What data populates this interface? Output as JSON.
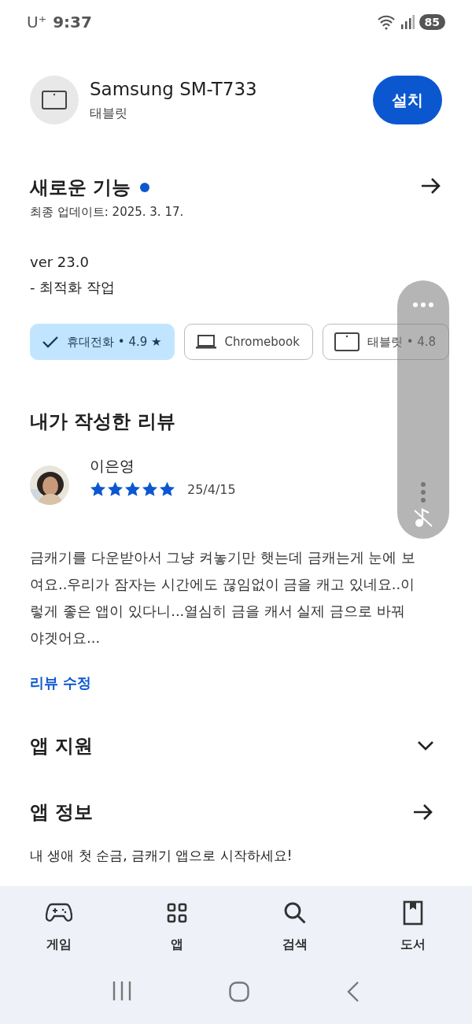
{
  "status_bar": {
    "carrier": "U⁺",
    "time": "9:37",
    "battery": "85"
  },
  "device": {
    "name": "Samsung SM-T733",
    "type": "태블릿",
    "install_button": "설치"
  },
  "whats_new": {
    "title": "새로운 기능",
    "new_dot": true,
    "updated": "최종 업데이트: 2025. 3. 17.",
    "version": "ver 23.0",
    "notes": "- 최적화 작업"
  },
  "device_chips": [
    {
      "label": "휴대전화 • 4.9 ★",
      "selected": true
    },
    {
      "kind": "laptop",
      "label": "Chromebook",
      "selected": false
    },
    {
      "kind": "tablet",
      "label": "태블릿 • 4.8",
      "selected": false
    }
  ],
  "my_review": {
    "title": "내가 작성한 리뷰",
    "author": "이은영",
    "stars": 5,
    "date": "25/4/15",
    "text": "금캐기를 다운받아서 그냥 켜놓기만 햇는데 금캐는게 눈에 보여요..우리가 잠자는 시간에도 끊임없이 금을 캐고 있네요..이렇게 좋은 앱이 있다니...열심히 금을 캐서 실제 금으로 바꿔야겟어요...",
    "edit_link": "리뷰 수정"
  },
  "sections": [
    {
      "kind": "expand",
      "title": "앱 지원"
    },
    {
      "kind": "arrow",
      "title": "앱 정보",
      "description": "내 생애 첫 순금, 금캐기 앱으로 시작하세요!"
    }
  ],
  "bottom_nav": [
    {
      "kind": "games",
      "label": "게임",
      "selected": false
    },
    {
      "kind": "apps",
      "label": "앱",
      "selected": false
    },
    {
      "kind": "search",
      "label": "검색",
      "selected": false
    },
    {
      "kind": "books",
      "label": "도서",
      "selected": false
    }
  ]
}
